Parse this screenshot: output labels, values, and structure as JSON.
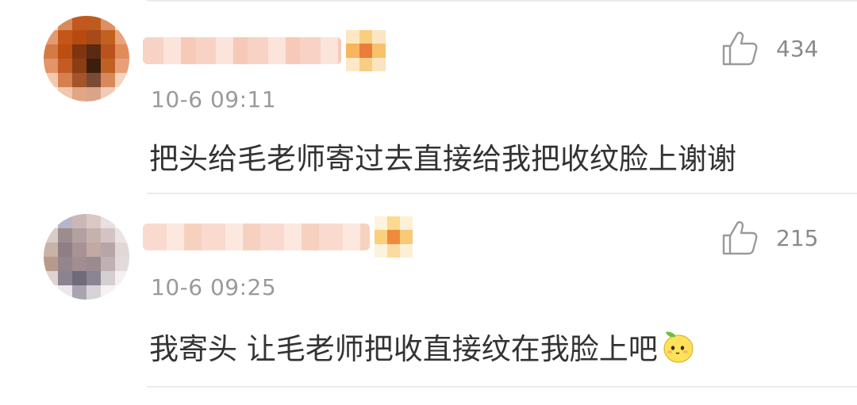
{
  "comments": [
    {
      "username": "",
      "time": "10-6 09:11",
      "text": "把头给毛老师寄过去直接给我把收纹脸上谢谢",
      "likes": "434",
      "avatar_colors": [
        "#f6e0d4",
        "#d98a5a",
        "#c2581e",
        "#bf5a1e",
        "#dd8f63",
        "#f7e4da",
        "#e49a6f",
        "#c4561a",
        "#b84a10",
        "#a54a18",
        "#c2601f",
        "#e7a47d",
        "#d57a45",
        "#bb4f12",
        "#7e3510",
        "#5a2a12",
        "#b9531b",
        "#df8b5a",
        "#e39468",
        "#c25c22",
        "#8b3e14",
        "#3d1e0d",
        "#c06123",
        "#e8a079",
        "#f3c9b0",
        "#d5804e",
        "#a3542a",
        "#7b4a35",
        "#d8895c",
        "#f4d3bf",
        "#fbf0ea",
        "#f0c6ae",
        "#e2a684",
        "#d9a48a",
        "#f1cbb5",
        "#fcf2ec"
      ],
      "badge_colors": [
        "#fde7c2",
        "#f9cf7f",
        "#fbe6c4",
        "#f7b55c",
        "#ea7d3b",
        "#f6c36b",
        "#fde9c9",
        "#f8cd85",
        "#fbe5c0"
      ]
    },
    {
      "username": "",
      "time": "10-6 09:25",
      "text": "我寄头 让毛老师把收直接纹在我脸上吧",
      "likes": "215",
      "avatar_colors": [
        "#f3f0f2",
        "#b8b5c9",
        "#cbb7b8",
        "#dcc7c4",
        "#e7e1e3",
        "#f6f4f5",
        "#d8ccc9",
        "#9c8c8f",
        "#b2a1a0",
        "#c5b2af",
        "#d3c4c3",
        "#eae4e5",
        "#c9b2a8",
        "#8f7f85",
        "#a89295",
        "#c2a9a4",
        "#b7a5a7",
        "#e2d7d7",
        "#b79a8c",
        "#93848d",
        "#a18d92",
        "#9c8a91",
        "#bfb0b3",
        "#e3dadb",
        "#e0d3cf",
        "#8d8390",
        "#6f6b7b",
        "#8a8493",
        "#d6cfd2",
        "#f4f0f1",
        "#fbf9fa",
        "#ece7ea",
        "#a9a4b0",
        "#d8d3d8",
        "#f5f2f3",
        "#fcfbfb"
      ],
      "badge_colors": [
        "#fef3dc",
        "#fbd98f",
        "#fdf0d7",
        "#fbcf7c",
        "#ef8a3c",
        "#f8c977",
        "#fdf2dc",
        "#fbdca0",
        "#fdefd6"
      ]
    }
  ],
  "icons": {
    "like": "thumbs-up-icon",
    "emoji": "lemon-emoji-icon"
  },
  "colors": {
    "text": "#333333",
    "meta": "#9a9a9a",
    "divider": "#ececec",
    "emoji_yellow": "#ffe15a",
    "emoji_leaf": "#6cbf3c"
  }
}
